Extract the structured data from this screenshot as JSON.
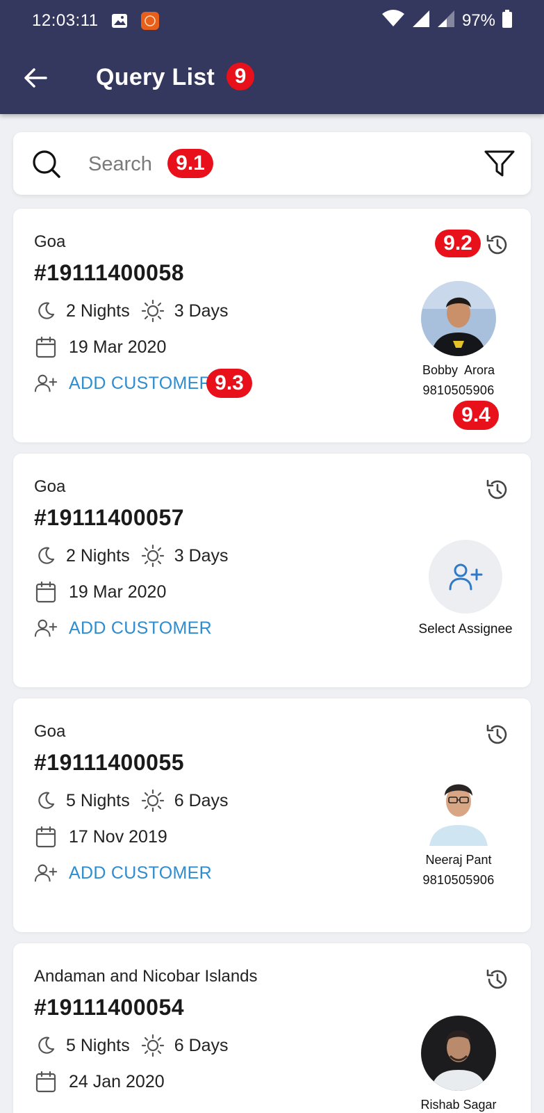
{
  "status_bar": {
    "time": "12:03:11",
    "battery": "97%"
  },
  "header": {
    "title": "Query List",
    "badge": "9"
  },
  "search": {
    "placeholder": "Search",
    "badge": "9.1"
  },
  "annotations": {
    "history": "9.2",
    "add_customer": "9.3",
    "assignee": "9.4"
  },
  "colors": {
    "appbar": "#34375e",
    "badge": "#e8101a",
    "link": "#2e8ccf"
  },
  "queries": [
    {
      "destination": "Goa",
      "id": "#19111400058",
      "nights": "2 Nights",
      "days": "3 Days",
      "date": "19 Mar 2020",
      "add_customer": "ADD CUSTOMER",
      "assignee": {
        "name": "Bobby  Arora",
        "phone": "9810505906"
      }
    },
    {
      "destination": "Goa",
      "id": "#19111400057",
      "nights": "2 Nights",
      "days": "3 Days",
      "date": "19 Mar 2020",
      "add_customer": "ADD CUSTOMER",
      "assignee_action": "Select Assignee"
    },
    {
      "destination": "Goa",
      "id": "#19111400055",
      "nights": "5 Nights",
      "days": "6 Days",
      "date": "17 Nov 2019",
      "add_customer": "ADD CUSTOMER",
      "assignee": {
        "name": "Neeraj Pant",
        "phone": "9810505906"
      }
    },
    {
      "destination": "Andaman and Nicobar Islands",
      "id": "#19111400054",
      "nights": "5 Nights",
      "days": "6 Days",
      "date": "24 Jan 2020",
      "assignee": {
        "name": "Rishab Sagar"
      }
    }
  ]
}
